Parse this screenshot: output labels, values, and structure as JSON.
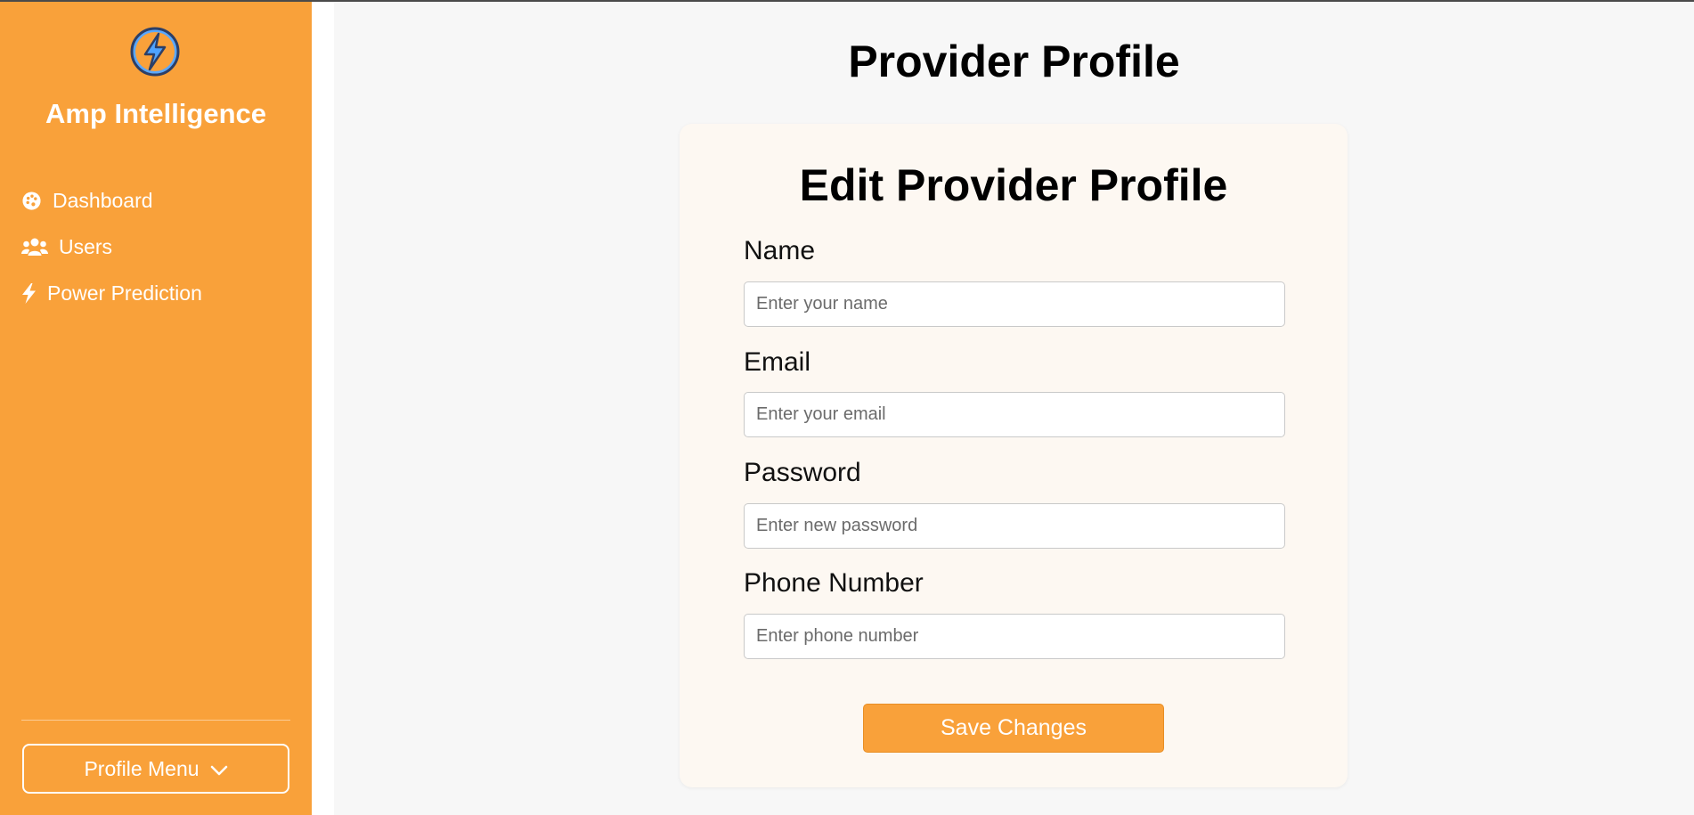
{
  "sidebar": {
    "brand": "Amp Intelligence",
    "logo_icon": "lightning-bolt-logo",
    "items": [
      {
        "label": "Dashboard",
        "icon": "palette-icon"
      },
      {
        "label": "Users",
        "icon": "users-icon"
      },
      {
        "label": "Power Prediction",
        "icon": "bolt-icon"
      }
    ],
    "profile_menu_label": "Profile Menu",
    "profile_menu_icon": "chevron-down-icon",
    "bg_color": "#f9a13a"
  },
  "main": {
    "page_title": "Provider Profile",
    "card_title": "Edit Provider Profile",
    "fields": [
      {
        "label": "Name",
        "placeholder": "Enter your name",
        "value": ""
      },
      {
        "label": "Email",
        "placeholder": "Enter your email",
        "value": ""
      },
      {
        "label": "Password",
        "placeholder": "Enter new password",
        "value": ""
      },
      {
        "label": "Phone Number",
        "placeholder": "Enter phone number",
        "value": ""
      }
    ],
    "save_label": "Save Changes",
    "accent_color": "#f9a13a"
  }
}
